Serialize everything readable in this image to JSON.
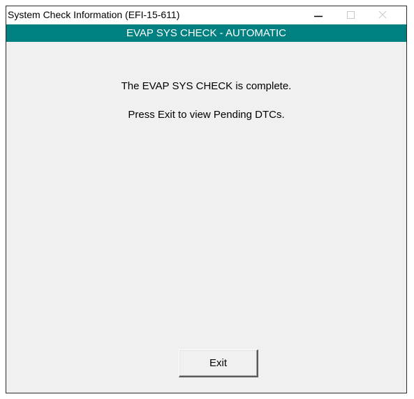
{
  "window": {
    "title": "System Check Information (EFI-15-611)",
    "controls": {
      "minimize_icon": "minimize-icon",
      "maximize_icon": "maximize-icon",
      "close_icon": "close-icon"
    }
  },
  "banner": {
    "text": "EVAP SYS CHECK - AUTOMATIC"
  },
  "messages": {
    "line1": "The EVAP SYS CHECK is complete.",
    "line2": "Press Exit to view Pending DTCs."
  },
  "buttons": {
    "exit_label": "Exit"
  },
  "colors": {
    "banner_bg": "#008080",
    "banner_text": "#ffffff",
    "content_bg": "#f0f0f0",
    "titlebar_bg": "#ffffff"
  }
}
